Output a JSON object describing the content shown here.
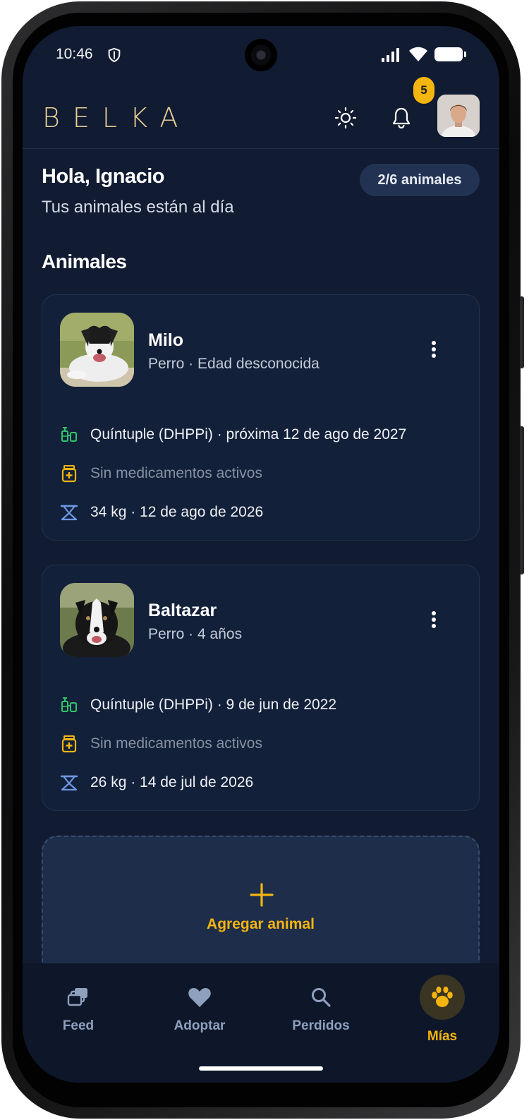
{
  "status_bar": {
    "time": "10:46"
  },
  "header": {
    "logo": "BELKA",
    "notification_count": "5"
  },
  "greeting": {
    "title": "Hola, Ignacio",
    "subtitle": "Tus animales están al día",
    "animal_count": "2/6 animales"
  },
  "section": {
    "title": "Animales"
  },
  "animals": [
    {
      "name": "Milo",
      "subtitle": "Perro · Edad desconocida",
      "vaccine": "Quíntuple (DHPPi) · próxima 12 de ago de 2027",
      "medication": "Sin medicamentos activos",
      "weight": "34 kg · 12 de ago de 2026"
    },
    {
      "name": "Baltazar",
      "subtitle": "Perro · 4 años",
      "vaccine": "Quíntuple (DHPPi) · 9 de jun de 2022",
      "medication": "Sin medicamentos activos",
      "weight": "26 kg · 14 de jul de 2026"
    }
  ],
  "add_animal": {
    "label": "Agregar animal"
  },
  "nav": [
    {
      "label": "Feed",
      "icon": "feed-icon"
    },
    {
      "label": "Adoptar",
      "icon": "heart-icon"
    },
    {
      "label": "Perdidos",
      "icon": "search-icon"
    },
    {
      "label": "Mías",
      "icon": "paw-icon",
      "active": true
    }
  ],
  "colors": {
    "background": "#111b31",
    "card": "#132039",
    "accent": "#f5b50f",
    "logo": "#e7cf98",
    "vaccine_icon": "#2fc46a",
    "medication_icon": "#f5b50f",
    "weight_icon": "#6e98e6"
  }
}
